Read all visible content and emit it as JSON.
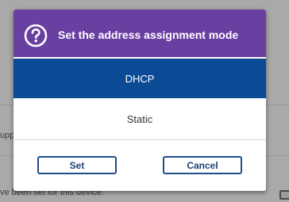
{
  "background": {
    "text_line_1": "upp",
    "text_line_2": "ve been set for this device."
  },
  "dialog": {
    "title": "Set the address assignment mode",
    "title_icon": "help-question-icon",
    "options": [
      {
        "label": "DHCP",
        "selected": true
      },
      {
        "label": "Static",
        "selected": false
      }
    ],
    "buttons": {
      "set_label": "Set",
      "cancel_label": "Cancel"
    }
  },
  "colors": {
    "header": "#6a3fa2",
    "selected_option": "#0b4a95",
    "button_border": "#1f4e8c"
  }
}
